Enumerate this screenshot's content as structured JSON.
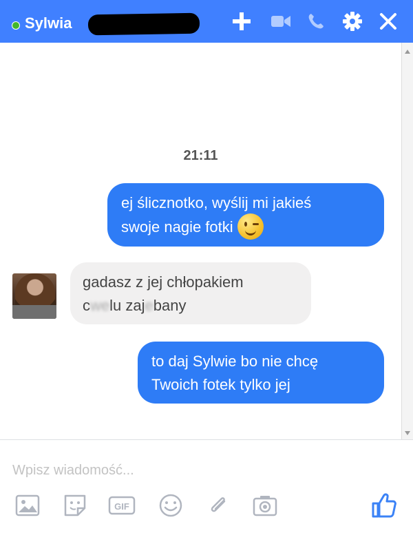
{
  "header": {
    "contact_name": "Sylwia",
    "online": true,
    "actions": [
      "add-person",
      "video-call",
      "voice-call",
      "settings",
      "close"
    ]
  },
  "conversation": {
    "timestamp": "21:11",
    "messages": [
      {
        "direction": "outgoing",
        "lines": [
          "ej ślicznotko, wyślij mi jakieś",
          "swoje nagie fotki"
        ],
        "emoji": "winking-face"
      },
      {
        "direction": "incoming",
        "lines": [
          "gadasz z jej chłopakiem"
        ],
        "line2_parts": [
          "c",
          "we",
          "lu zaj",
          "e",
          "bany"
        ]
      },
      {
        "direction": "outgoing",
        "lines": [
          "to daj Sylwie bo nie chcę",
          "Twoich fotek tylko jej"
        ]
      }
    ]
  },
  "composer": {
    "placeholder": "Wpisz wiadomość...",
    "tools": [
      "photo-icon",
      "sticker-icon",
      "gif-icon",
      "emoji-icon",
      "attachment-icon",
      "camera-icon",
      "like-icon"
    ]
  },
  "colors": {
    "header_bg": "#4080ff",
    "outgoing_bubble": "#2e7cf6",
    "incoming_bubble": "#f1f0f0",
    "online_dot": "#42b72a",
    "icon_gray": "#b0b5bf",
    "like_blue": "#3b82f6"
  }
}
